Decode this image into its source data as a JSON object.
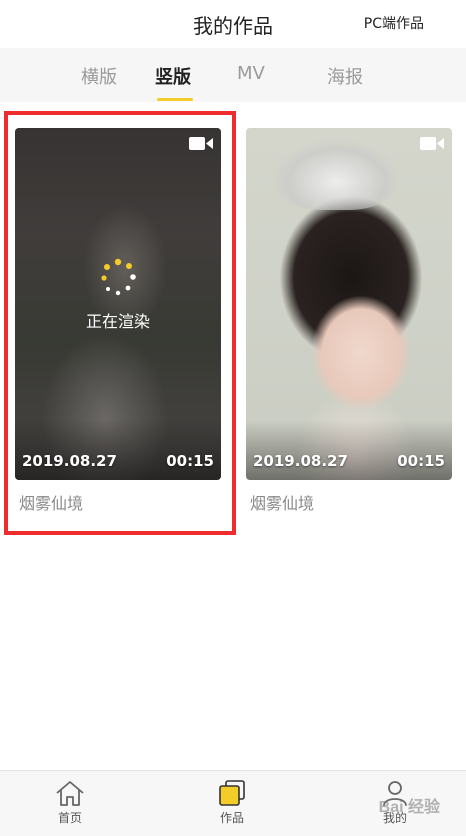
{
  "header": {
    "title": "我的作品",
    "pc_link": "PC端作品"
  },
  "tabs": [
    {
      "label": "横版",
      "active": false
    },
    {
      "label": "竖版",
      "active": true
    },
    {
      "label": "MV",
      "active": false
    },
    {
      "label": "海报",
      "active": false
    }
  ],
  "works": [
    {
      "date": "2019.08.27",
      "duration": "00:15",
      "name": "烟雾仙境",
      "status": "正在渲染",
      "icon": "video-camera-icon"
    },
    {
      "date": "2019.08.27",
      "duration": "00:15",
      "name": "烟雾仙境",
      "icon": "video-camera-icon"
    }
  ],
  "bottom_nav": [
    {
      "label": "首页",
      "icon": "home-icon"
    },
    {
      "label": "作品",
      "icon": "works-icon",
      "active": true
    },
    {
      "label": "我的",
      "icon": "profile-icon"
    }
  ],
  "watermark": "Bai 经验",
  "colors": {
    "accent": "#f3cc2a",
    "highlight": "#ee2c2c"
  }
}
